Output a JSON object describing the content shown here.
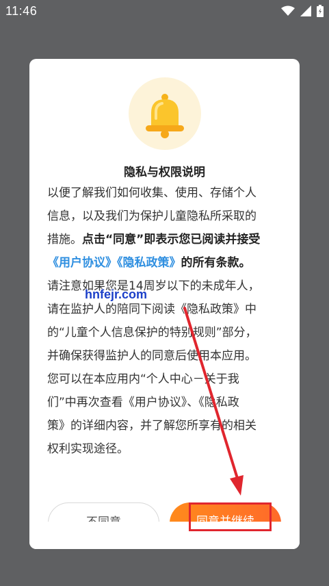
{
  "status": {
    "time": "11:46"
  },
  "dialog": {
    "title": "隐私与权限说明",
    "lines": [
      "以便了解我们如何收集、使用、存储个人",
      "信息，以及我们为保护儿童隐私所采取的",
      "措施。",
      "点击“同意”即表示您已阅读并接受",
      "《用户协议》",
      "《隐私政策》",
      "的所有条款。",
      "请注意如果您是14周岁以下的未成年人，",
      "请在监护人的陪同下阅读《隐私政策》中",
      "的“儿童个人信息保护的特别规则”部分，",
      "并确保获得监护人的同意后使用本应用。",
      "您可以在本应用内“个人中心－关于我",
      "们”中再次查看《用户协议》、《隐私政",
      "策》的详细内容，并了解您所享有的相关",
      "权利实现途径。"
    ],
    "disagree_label": "不同意",
    "agree_label": "同意并继续"
  },
  "watermark": "hnfejr.com",
  "colors": {
    "accent": "#ff7a22",
    "link": "#2f8fe0",
    "annotation": "#e0262e"
  },
  "icons": {
    "bell": "bell-icon",
    "wifi": "wifi-icon",
    "signal": "signal-icon",
    "battery": "battery-icon"
  }
}
